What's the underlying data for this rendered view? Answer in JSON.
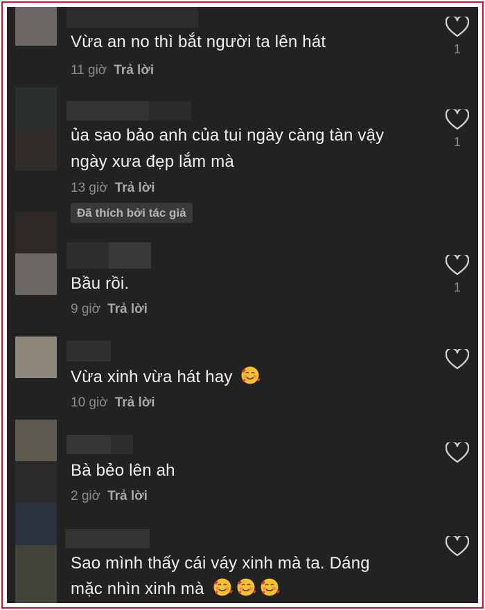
{
  "comments": [
    {
      "text": "Vừa an no thì bắt người ta lên hát",
      "time": "11 giờ",
      "reply": "Trả lời",
      "likes": "1"
    },
    {
      "text_line1": "ủa sao bảo anh của tui ngày càng tàn vậy",
      "text_line2": "ngày xưa đẹp lắm mà",
      "time": "13 giờ",
      "reply": "Trả lời",
      "likes": "1",
      "badge": "Đã thích bởi tác giả"
    },
    {
      "text": "Bầu rồi.",
      "time": "9 giờ",
      "reply": "Trả lời",
      "likes": "1"
    },
    {
      "text": "Vừa xinh vừa hát hay",
      "time": "10 giờ",
      "reply": "Trả lời",
      "emoji": "smiling-face-with-hearts"
    },
    {
      "text": "Bà bẻo lên ah",
      "time": "2 giờ",
      "reply": "Trả lời"
    },
    {
      "text_line1": "Sao mình thấy cái váy xinh mà ta. Dáng",
      "text_line2": "mặc nhìn xinh mà",
      "emoji": "smiling-face-with-hearts",
      "emoji_count": 3
    }
  ],
  "icons": {
    "like": "heart-outline-icon"
  },
  "colors": {
    "background": "#222222",
    "frame_border": "#d0102a",
    "text": "#f1f1f1",
    "meta": "#8c8c8c"
  }
}
